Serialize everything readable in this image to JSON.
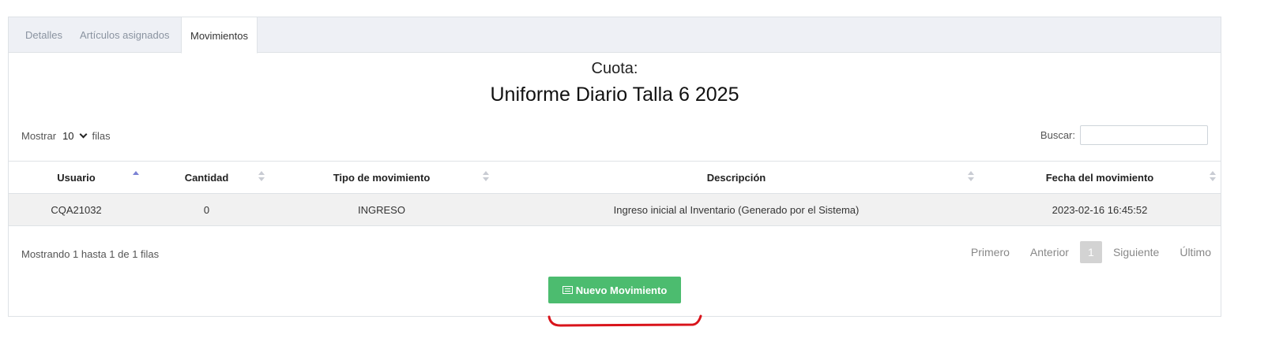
{
  "tabs": [
    {
      "label": "Detalles"
    },
    {
      "label": "Artículos asignados"
    },
    {
      "label": "Movimientos"
    }
  ],
  "heading": {
    "line1": "Cuota:",
    "line2": "Uniforme Diario Talla 6 2025"
  },
  "length_control": {
    "prefix": "Mostrar",
    "value": "10",
    "suffix": "filas"
  },
  "search": {
    "label": "Buscar:",
    "value": ""
  },
  "table": {
    "columns": [
      "Usuario",
      "Cantidad",
      "Tipo de movimiento",
      "Descripción",
      "Fecha del movimiento"
    ],
    "sorted_column": "Usuario",
    "rows": [
      [
        "CQA21032",
        "0",
        "INGRESO",
        "Ingreso inicial al Inventario (Generado por el Sistema)",
        "2023-02-16 16:45:52"
      ]
    ]
  },
  "info": "Mostrando 1 hasta 1 de 1 filas",
  "pagination": {
    "first": "Primero",
    "previous": "Anterior",
    "current": "1",
    "next": "Siguiente",
    "last": "Último"
  },
  "new_button": {
    "label": "Nuevo Movimiento",
    "icon": "list-icon",
    "color": "#4cbc6f"
  },
  "annotation_color": "#d9141b"
}
